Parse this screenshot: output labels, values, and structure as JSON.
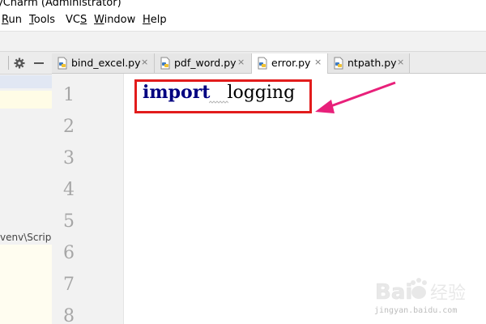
{
  "window": {
    "title": "yCharm (Administrator)"
  },
  "menu": {
    "items": [
      {
        "label": "Run",
        "mnemonic_index": 0
      },
      {
        "label": "Tools",
        "mnemonic_index": 0
      },
      {
        "label": "VCS",
        "mnemonic_index": 2
      },
      {
        "label": "Window",
        "mnemonic_index": 0
      },
      {
        "label": "Help",
        "mnemonic_index": 0
      }
    ]
  },
  "project_panel": {
    "settings_icon": "gear-icon",
    "hide_icon": "minimize-icon",
    "path_fragment": "\\venv\\Scrip"
  },
  "tabs": [
    {
      "label": "bind_excel.py",
      "close": "×",
      "active": false
    },
    {
      "label": "pdf_word.py",
      "close": "×",
      "active": false
    },
    {
      "label": "error.py",
      "close": "×",
      "active": true
    },
    {
      "label": "ntpath.py",
      "close": "×",
      "active": false
    }
  ],
  "editor": {
    "line_numbers": [
      "1",
      "2",
      "3",
      "4",
      "5",
      "6",
      "7",
      "8"
    ],
    "code": {
      "keyword": "import",
      "module": "logging"
    }
  },
  "annotation": {
    "box_color": "#e21c1c",
    "arrow_color": "#e8207a"
  },
  "watermark": {
    "site": "jingyan.baidu.com",
    "logo_text": "Bai经验"
  },
  "colors": {
    "keyword": "#000080",
    "line_number": "#a6a6a6"
  }
}
